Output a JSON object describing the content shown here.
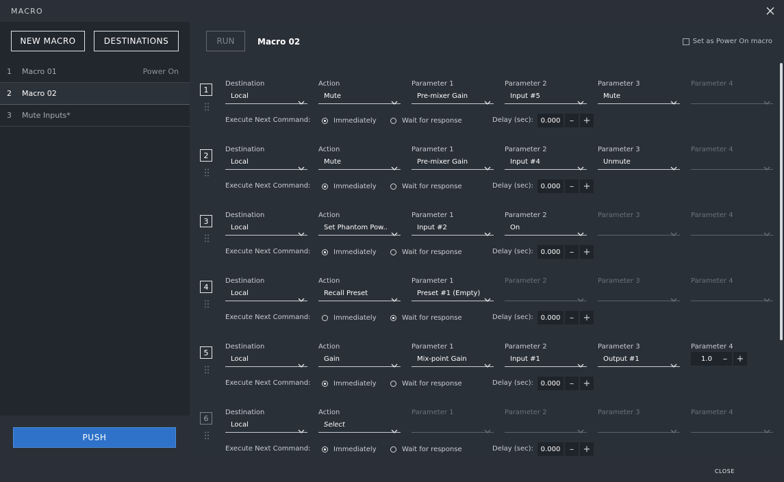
{
  "window": {
    "title": "MACRO"
  },
  "left": {
    "new_macro_label": "NEW MACRO",
    "destinations_label": "DESTINATIONS",
    "macros": [
      {
        "num": "1",
        "name": "Macro 01",
        "tag": "Power On",
        "active": false
      },
      {
        "num": "2",
        "name": "Macro 02",
        "tag": "",
        "active": true
      },
      {
        "num": "3",
        "name": "Mute Inputs*",
        "tag": "",
        "active": false
      }
    ],
    "push_label": "PUSH"
  },
  "main": {
    "run_label": "RUN",
    "macro_name": "Macro 02",
    "power_on_label": "Set as Power On macro",
    "power_on_checked": false,
    "exec_label": "Execute Next Command:",
    "immediately_label": "Immediately",
    "wait_label": "Wait for response",
    "delay_label": "Delay (sec):",
    "commands": [
      {
        "index": "1",
        "enabled": true,
        "fields": [
          {
            "label": "Destination",
            "value": "Local",
            "enabled": true
          },
          {
            "label": "Action",
            "value": "Mute",
            "enabled": true
          },
          {
            "label": "Parameter 1",
            "value": "Pre-mixer Gain",
            "enabled": true
          },
          {
            "label": "Parameter 2",
            "value": "Input #5",
            "enabled": true
          },
          {
            "label": "Parameter 3",
            "value": "Mute",
            "enabled": true
          },
          {
            "label": "Parameter 4",
            "value": "",
            "enabled": false
          }
        ],
        "execute": "immediately",
        "delay": "0.000"
      },
      {
        "index": "2",
        "enabled": true,
        "fields": [
          {
            "label": "Destination",
            "value": "Local",
            "enabled": true
          },
          {
            "label": "Action",
            "value": "Mute",
            "enabled": true
          },
          {
            "label": "Parameter 1",
            "value": "Pre-mixer Gain",
            "enabled": true
          },
          {
            "label": "Parameter 2",
            "value": "Input #4",
            "enabled": true
          },
          {
            "label": "Parameter 3",
            "value": "Unmute",
            "enabled": true
          },
          {
            "label": "Parameter 4",
            "value": "",
            "enabled": false
          }
        ],
        "execute": "immediately",
        "delay": "0.000"
      },
      {
        "index": "3",
        "enabled": true,
        "fields": [
          {
            "label": "Destination",
            "value": "Local",
            "enabled": true
          },
          {
            "label": "Action",
            "value": "Set Phantom Pow...",
            "enabled": true
          },
          {
            "label": "Parameter 1",
            "value": "Input #2",
            "enabled": true
          },
          {
            "label": "Parameter 2",
            "value": "On",
            "enabled": true
          },
          {
            "label": "Parameter 3",
            "value": "",
            "enabled": false
          },
          {
            "label": "Parameter 4",
            "value": "",
            "enabled": false
          }
        ],
        "execute": "immediately",
        "delay": "0.000"
      },
      {
        "index": "4",
        "enabled": true,
        "fields": [
          {
            "label": "Destination",
            "value": "Local",
            "enabled": true
          },
          {
            "label": "Action",
            "value": "Recall Preset",
            "enabled": true
          },
          {
            "label": "Parameter 1",
            "value": "Preset #1 (Empty)",
            "enabled": true
          },
          {
            "label": "Parameter 2",
            "value": "",
            "enabled": false
          },
          {
            "label": "Parameter 3",
            "value": "",
            "enabled": false
          },
          {
            "label": "Parameter 4",
            "value": "",
            "enabled": false
          }
        ],
        "execute": "wait",
        "delay": "0.000"
      },
      {
        "index": "5",
        "enabled": true,
        "fields": [
          {
            "label": "Destination",
            "value": "Local",
            "enabled": true
          },
          {
            "label": "Action",
            "value": "Gain",
            "enabled": true
          },
          {
            "label": "Parameter 1",
            "value": "Mix-point Gain",
            "enabled": true
          },
          {
            "label": "Parameter 2",
            "value": "Input #1",
            "enabled": true
          },
          {
            "label": "Parameter 3",
            "value": "Output #1",
            "enabled": true
          },
          {
            "label": "Parameter 4",
            "value": "1.0",
            "enabled": true,
            "stepper": true
          }
        ],
        "execute": "immediately",
        "delay": "0.000"
      },
      {
        "index": "6",
        "enabled": false,
        "fields": [
          {
            "label": "Destination",
            "value": "Local",
            "enabled": true
          },
          {
            "label": "Action",
            "value": "Select",
            "enabled": true,
            "italic": true
          },
          {
            "label": "Parameter 1",
            "value": "",
            "enabled": false
          },
          {
            "label": "Parameter 2",
            "value": "",
            "enabled": false
          },
          {
            "label": "Parameter 3",
            "value": "",
            "enabled": false
          },
          {
            "label": "Parameter 4",
            "value": "",
            "enabled": false
          }
        ],
        "execute": "immediately",
        "delay": "0.000"
      }
    ]
  },
  "footer": {
    "close_label": "CLOSE"
  },
  "icons": {
    "close": "close-icon",
    "chevron": "chevron-down-icon",
    "drag": "drag-handle-icon",
    "minus": "minus-icon",
    "plus": "plus-icon"
  },
  "colors": {
    "primary": "#2e72c9",
    "panel": "#22272e",
    "background": "#2a3038"
  }
}
